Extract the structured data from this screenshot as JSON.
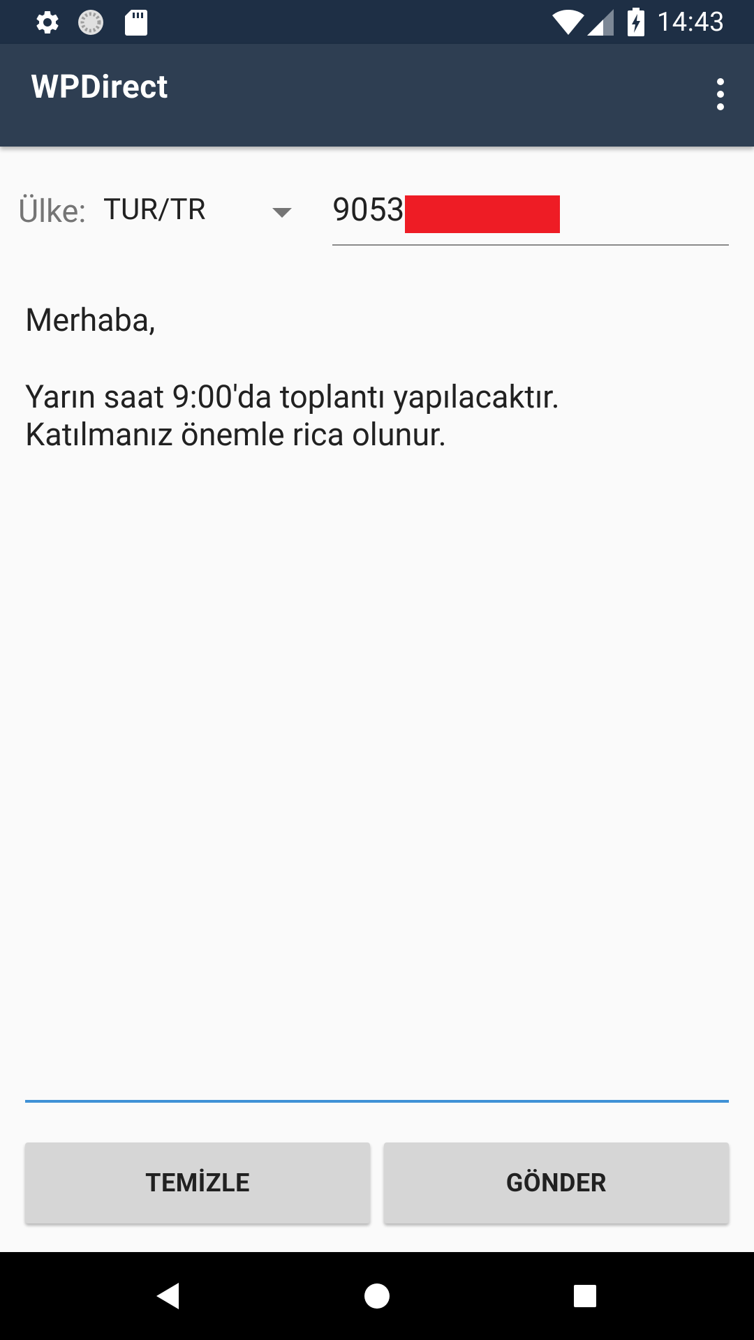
{
  "status_bar": {
    "time": "14:43",
    "left_icons": [
      "settings-icon",
      "sync-icon",
      "sd-card-icon"
    ],
    "right_icons": [
      "wifi-icon",
      "cellular-signal-icon",
      "battery-charging-icon"
    ]
  },
  "app_bar": {
    "title": "WPDirect",
    "menu_icon": "more-vert-icon"
  },
  "form": {
    "country_label": "Ülke:",
    "country_value": "TUR/TR",
    "phone_value": "9053"
  },
  "message": {
    "lines": [
      "Merhaba,",
      "",
      "Yarın saat 9:00'da toplantı yapılacaktır.",
      "Katılmanız önemle rica olunur."
    ]
  },
  "buttons": {
    "clear_label": "TEMİZLE",
    "send_label": "GÖNDER"
  },
  "nav_bar": {
    "icons": [
      "back-icon",
      "home-icon",
      "recents-icon"
    ]
  },
  "colors": {
    "status_bar": "#1e2f45",
    "app_bar": "#2e3e52",
    "accent": "#3f91d6",
    "redaction": "#ee1c25",
    "button": "#d6d6d6"
  }
}
